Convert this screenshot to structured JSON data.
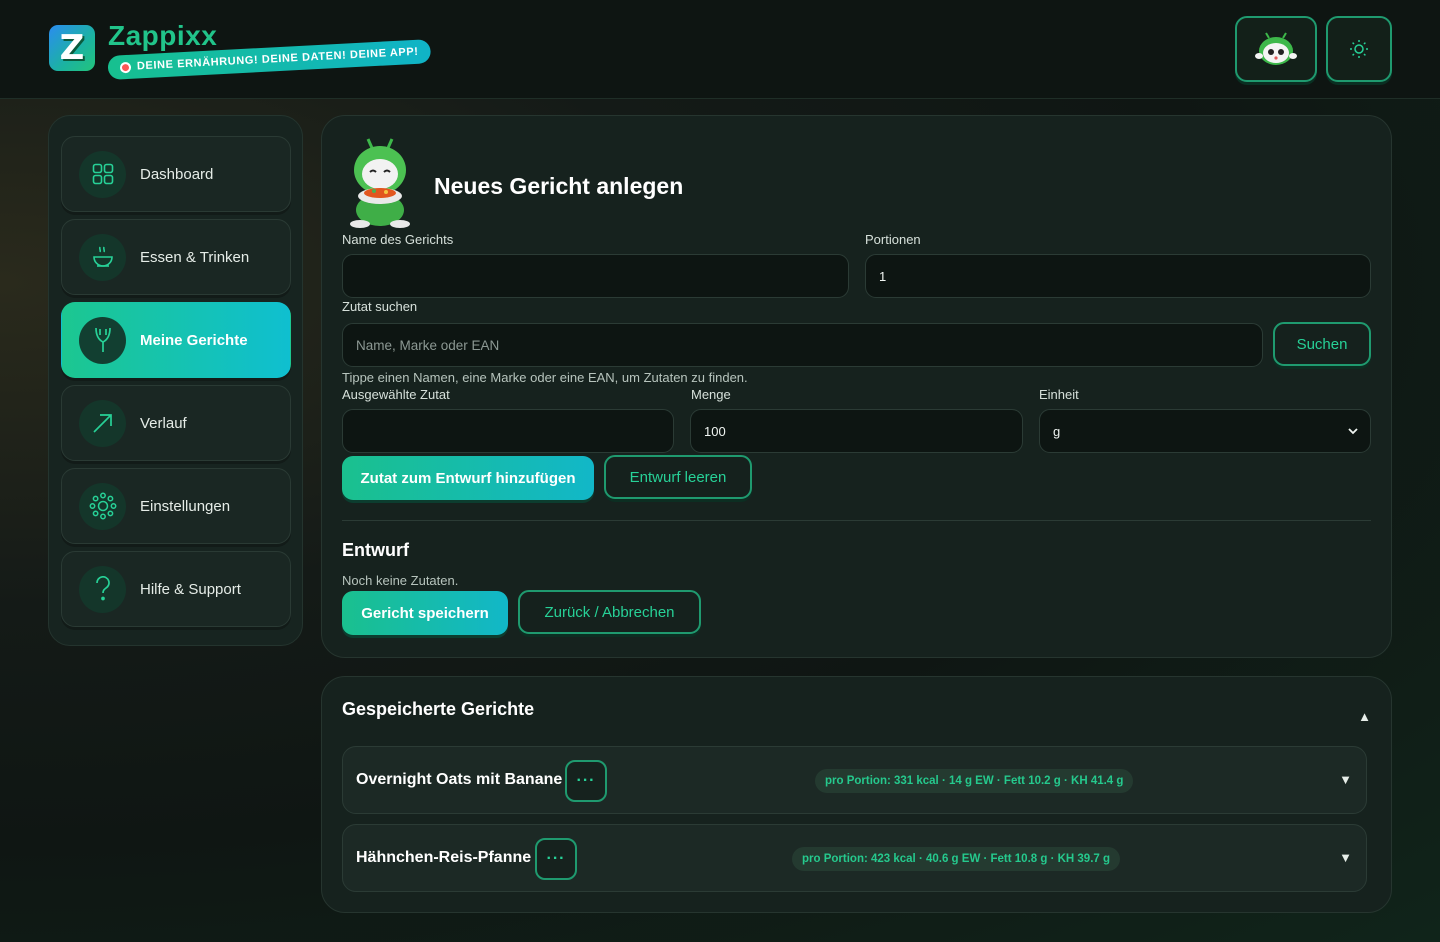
{
  "app": {
    "name": "Zappixx",
    "logo_letter": "Z",
    "tagline": "DEINE ERNÄHRUNG! DEINE DATEN! DEINE APP!"
  },
  "header": {
    "avatar_icon": "mascot-avatar-icon",
    "theme_icon": "sun-icon"
  },
  "sidebar": {
    "items": [
      {
        "label": "Dashboard",
        "icon": "grid-icon",
        "active": false
      },
      {
        "label": "Essen & Trinken",
        "icon": "bowl-icon",
        "active": false
      },
      {
        "label": "Meine Gerichte",
        "icon": "fork-icon",
        "active": true
      },
      {
        "label": "Verlauf",
        "icon": "trend-arrow-icon",
        "active": false
      },
      {
        "label": "Einstellungen",
        "icon": "gear-icon",
        "active": false
      },
      {
        "label": "Hilfe & Support",
        "icon": "question-icon",
        "active": false
      }
    ]
  },
  "new_dish": {
    "title": "Neues Gericht anlegen",
    "name_label": "Name des Gerichts",
    "name_value": "",
    "portions_label": "Portionen",
    "portions_value": "1",
    "search_label": "Zutat suchen",
    "search_placeholder": "Name, Marke oder EAN",
    "search_button": "Suchen",
    "search_hint": "Tippe einen Namen, eine Marke oder eine EAN, um Zutaten zu finden.",
    "selected_label": "Ausgewählte Zutat",
    "selected_value": "",
    "amount_label": "Menge",
    "amount_value": "100",
    "unit_label": "Einheit",
    "unit_value": "g",
    "add_button": "Zutat zum Entwurf hinzufügen",
    "clear_button": "Entwurf leeren",
    "draft_title": "Entwurf",
    "draft_empty": "Noch keine Zutaten.",
    "save_button": "Gericht speichern",
    "cancel_button": "Zurück / Abbrechen"
  },
  "saved": {
    "title": "Gespeicherte Gerichte",
    "dishes": [
      {
        "name": "Overnight Oats mit Banane",
        "nutrition": "pro Portion: 331 kcal · 14 g EW · Fett 10.2 g · KH 41.4 g"
      },
      {
        "name": "Hähnchen-Reis-Pfanne",
        "nutrition": "pro Portion: 423 kcal · 40.6 g EW · Fett 10.8 g · KH 39.7 g"
      }
    ],
    "menu_glyph": "···",
    "expand_glyph": "▼",
    "collapse_glyph": "▲"
  },
  "colors": {
    "accent": "#1ec48c",
    "accent_cyan": "#10b7c8",
    "background": "#111a16",
    "card": "#16221e"
  }
}
